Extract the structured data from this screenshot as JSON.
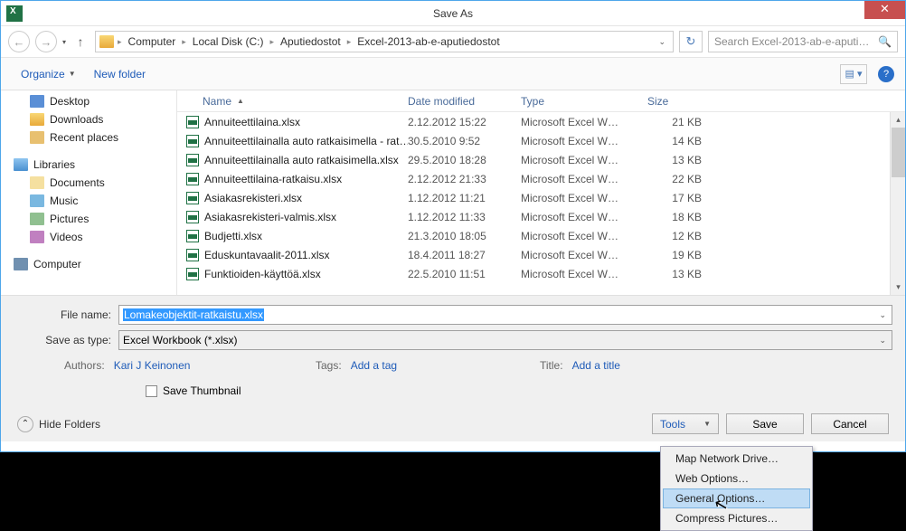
{
  "title": "Save As",
  "breadcrumb": [
    "Computer",
    "Local Disk (C:)",
    "Aputiedostot",
    "Excel-2013-ab-e-aputiedostot"
  ],
  "search_placeholder": "Search Excel-2013-ab-e-aputi…",
  "toolbar": {
    "organize": "Organize",
    "newfolder": "New folder"
  },
  "sidebar": {
    "desktop": "Desktop",
    "downloads": "Downloads",
    "recent": "Recent places",
    "libraries": "Libraries",
    "documents": "Documents",
    "music": "Music",
    "pictures": "Pictures",
    "videos": "Videos",
    "computer": "Computer"
  },
  "columns": {
    "name": "Name",
    "date": "Date modified",
    "type": "Type",
    "size": "Size"
  },
  "files": [
    {
      "name": "Annuiteettilaina.xlsx",
      "date": "2.12.2012 15:22",
      "type": "Microsoft Excel W…",
      "size": "21 KB"
    },
    {
      "name": "Annuiteettilainalla auto ratkaisimella - rat…",
      "date": "30.5.2010 9:52",
      "type": "Microsoft Excel W…",
      "size": "14 KB"
    },
    {
      "name": "Annuiteettilainalla auto ratkaisimella.xlsx",
      "date": "29.5.2010 18:28",
      "type": "Microsoft Excel W…",
      "size": "13 KB"
    },
    {
      "name": "Annuiteettilaina-ratkaisu.xlsx",
      "date": "2.12.2012 21:33",
      "type": "Microsoft Excel W…",
      "size": "22 KB"
    },
    {
      "name": "Asiakasrekisteri.xlsx",
      "date": "1.12.2012 11:21",
      "type": "Microsoft Excel W…",
      "size": "17 KB"
    },
    {
      "name": "Asiakasrekisteri-valmis.xlsx",
      "date": "1.12.2012 11:33",
      "type": "Microsoft Excel W…",
      "size": "18 KB"
    },
    {
      "name": "Budjetti.xlsx",
      "date": "21.3.2010 18:05",
      "type": "Microsoft Excel W…",
      "size": "12 KB"
    },
    {
      "name": "Eduskuntavaalit-2011.xlsx",
      "date": "18.4.2011 18:27",
      "type": "Microsoft Excel W…",
      "size": "19 KB"
    },
    {
      "name": "Funktioiden-käyttöä.xlsx",
      "date": "22.5.2010 11:51",
      "type": "Microsoft Excel W…",
      "size": "13 KB"
    }
  ],
  "filename_label": "File name:",
  "filename_value": "Lomakeobjektit-ratkaistu.xlsx",
  "savetype_label": "Save as type:",
  "savetype_value": "Excel Workbook (*.xlsx)",
  "authors_label": "Authors:",
  "authors_value": "Kari J Keinonen",
  "tags_label": "Tags:",
  "tags_value": "Add a tag",
  "title_label": "Title:",
  "title_value": "Add a title",
  "thumb_label": "Save Thumbnail",
  "hide_folders": "Hide Folders",
  "buttons": {
    "tools": "Tools",
    "save": "Save",
    "cancel": "Cancel"
  },
  "tools_menu": {
    "map": "Map Network Drive…",
    "web": "Web Options…",
    "general": "General Options…",
    "compress": "Compress Pictures…"
  }
}
